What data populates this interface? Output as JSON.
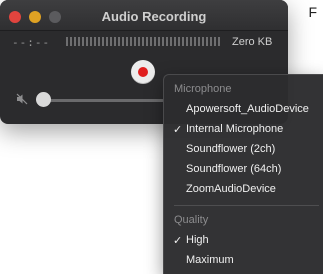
{
  "background_page": {
    "text_fragment": "F"
  },
  "window": {
    "title": "Audio Recording",
    "timer": "--:--",
    "file_size": "Zero KB",
    "record_color": "#e01e1e"
  },
  "menu": {
    "microphone_header": "Microphone",
    "microphone_items": [
      {
        "label": "Apowersoft_AudioDevice",
        "checked": false
      },
      {
        "label": "Internal Microphone",
        "checked": true
      },
      {
        "label": "Soundflower (2ch)",
        "checked": false
      },
      {
        "label": "Soundflower (64ch)",
        "checked": false
      },
      {
        "label": "ZoomAudioDevice",
        "checked": false
      }
    ],
    "quality_header": "Quality",
    "quality_items": [
      {
        "label": "High",
        "checked": true
      },
      {
        "label": "Maximum",
        "checked": false
      }
    ],
    "checkmark": "✓"
  },
  "icons": {
    "mute": "speaker-muted-icon",
    "record": "record-icon"
  }
}
